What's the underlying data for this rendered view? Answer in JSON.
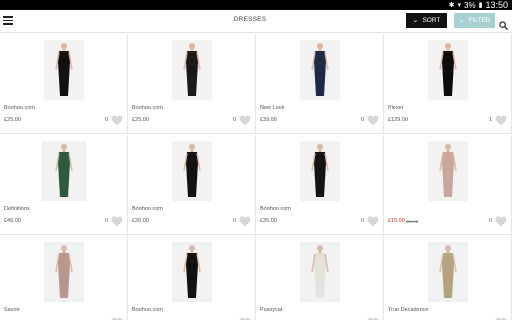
{
  "status_bar": {
    "signal": "3%",
    "time": "13:50"
  },
  "app_bar": {
    "title": "DRESSES",
    "sort_label": "SORT",
    "filter_label": "FILTER"
  },
  "products": [
    {
      "brand": "Boohoo.com",
      "price": "£25.00",
      "likes": "0",
      "dress_color": "#111111"
    },
    {
      "brand": "Boohoo.com",
      "price": "£25.00",
      "likes": "0",
      "dress_color": "#1a1a1a"
    },
    {
      "brand": "New Look",
      "price": "£39.99",
      "likes": "0",
      "dress_color": "#1f2a44"
    },
    {
      "brand": "Plexer",
      "price": "£129.00",
      "likes": "1",
      "dress_color": "#0d0d0d"
    },
    {
      "brand": "Definitions",
      "price": "£49.00",
      "likes": "0",
      "dress_color": "#2f5a3e"
    },
    {
      "brand": "Boohoo.com",
      "price": "£30.00",
      "likes": "0",
      "dress_color": "#121212"
    },
    {
      "brand": "Boohoo.com",
      "price": "£35.00",
      "likes": "0",
      "dress_color": "#141414"
    },
    {
      "brand": "",
      "price": "£15.99",
      "was_price": "£34.75",
      "likes": "0",
      "dress_color": "#c8a89c"
    },
    {
      "brand": "Savoir",
      "price": "",
      "likes": "",
      "dress_color": "#b8988e"
    },
    {
      "brand": "Boohoo.com",
      "price": "",
      "likes": "",
      "dress_color": "#111111"
    },
    {
      "brand": "Pussycat",
      "price": "",
      "likes": "",
      "dress_color": "#e6e2dc"
    },
    {
      "brand": "True Decadence",
      "price": "",
      "likes": "",
      "dress_color": "#b5a280"
    }
  ],
  "icons": {
    "menu": "hamburger-menu-icon",
    "search": "search-icon",
    "heart": "heart-icon",
    "chevron": "chevron-down-icon"
  }
}
